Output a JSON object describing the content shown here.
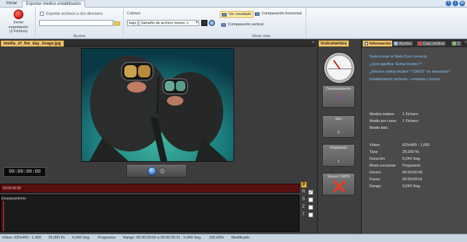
{
  "tabs": [
    "Iniciar",
    "Exportar medios estabilizados"
  ],
  "ribbon": {
    "start_line1": "Iniciar exportación",
    "start_line2": "(1 Fichero)",
    "export_other_dir": "Exportar archivos a otro directorio",
    "ajustes_label": "Ajustes",
    "calidad_label": "Calidad:",
    "calidad_level": "bajo",
    "calidad_option": "(tamaño de archivo menor, c",
    "view_result": "Ver resultado",
    "compare_h": "Comparación horizontal",
    "compare_v": "Comparación vertical",
    "modo_vista_label": "Modo vista"
  },
  "left": {
    "file_tab": "media_of_the_day_image.jpg",
    "timecode": "00:00:00:00",
    "timeline_label": "00:00:00:00",
    "graph_label": "Desplazamiento",
    "p_label": "P",
    "rows": [
      {
        "label": "R",
        "checked": "✓"
      },
      {
        "label": "S",
        "checked": ""
      },
      {
        "label": "Z",
        "checked": ""
      },
      {
        "label": "T",
        "checked": ""
      }
    ]
  },
  "instruments": {
    "tab": "Instrumentos",
    "desplazamiento": "Desplazamiento",
    "giro": "Giro",
    "giro_val": "0",
    "ampliacion": "Ampliación",
    "ampliacion_val": "1",
    "cmos": "Sensor CMOS"
  },
  "info": {
    "tabs": [
      "Información",
      "Ajustes",
      "Carp medios",
      "C"
    ],
    "links": [
      "Seleccionar la Stabi-Cam correcta",
      "¿Qué significa \"Evitar bordes\"?",
      "¿Efectos rolling-shutter / \"CMOS\" no deseados?",
      "Estabilización perfecta - consejos y trucos"
    ],
    "stats": [
      {
        "k": "Medios totales:",
        "v": "1 Fichero"
      },
      {
        "k": "Medio por crear:",
        "v": "1 Fichero"
      },
      {
        "k": "Medio listo:",
        "v": "-"
      }
    ],
    "video": [
      {
        "k": "Vídeo:",
        "v": "620x465 : 1,000"
      },
      {
        "k": "Tasa:",
        "v": "25,000 f/s"
      },
      {
        "k": "Duración:",
        "v": "0,040 Seg."
      },
      {
        "k": "Modo escanear:",
        "v": "Progresivo"
      },
      {
        "k": "Dentro:",
        "v": "00:00:00:00"
      },
      {
        "k": "Fuera:",
        "v": "00:00:00:01"
      },
      {
        "k": "Rango:",
        "v": "0,040 Seg."
      }
    ]
  },
  "status": {
    "items": [
      "Vídeo: 620x465 : 1,000",
      "25,000 f/s",
      "0,040 Seg.",
      "Progresivo",
      "Rango: 00:00:00:00 a 00:00:00:01 : 0,040 Seg.",
      "100,00%",
      "Modificado"
    ]
  }
}
